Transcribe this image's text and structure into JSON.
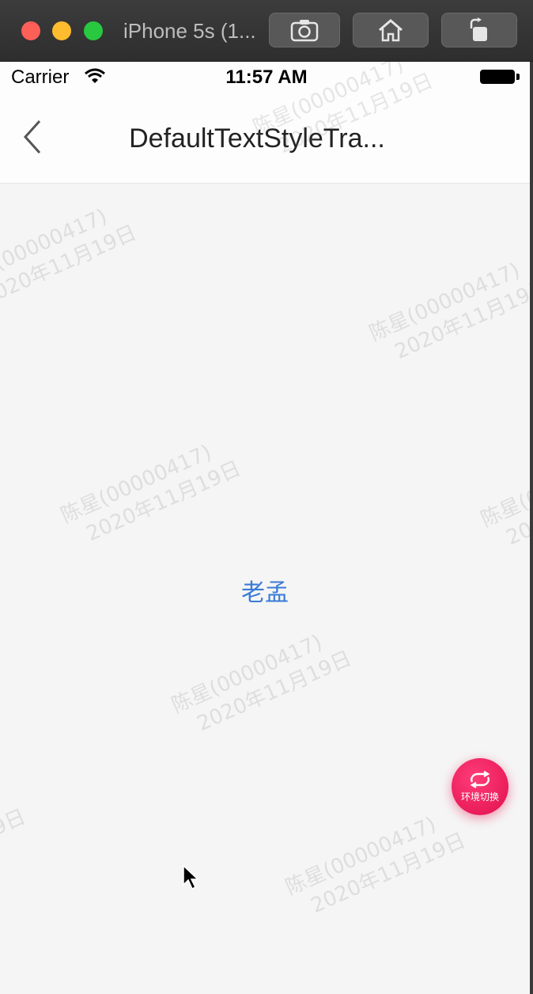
{
  "simulator": {
    "title": "iPhone 5s (1...",
    "buttons": [
      {
        "icon": "screenshot-icon"
      },
      {
        "icon": "home-icon"
      },
      {
        "icon": "rotate-icon"
      }
    ]
  },
  "statusbar": {
    "carrier": "Carrier",
    "time": "11:57 AM"
  },
  "navbar": {
    "title": "DefaultTextStyleTra...",
    "back_icon": "chevron-left-icon"
  },
  "content": {
    "text": "老孟"
  },
  "watermark": {
    "line1": "陈星(00000417)",
    "line2": "2020年11月19日"
  },
  "env_switch": {
    "label": "环境切换",
    "icon": "switch-icon",
    "color": "#e8175d"
  },
  "colors": {
    "accent_text": "#3a7bd5"
  }
}
